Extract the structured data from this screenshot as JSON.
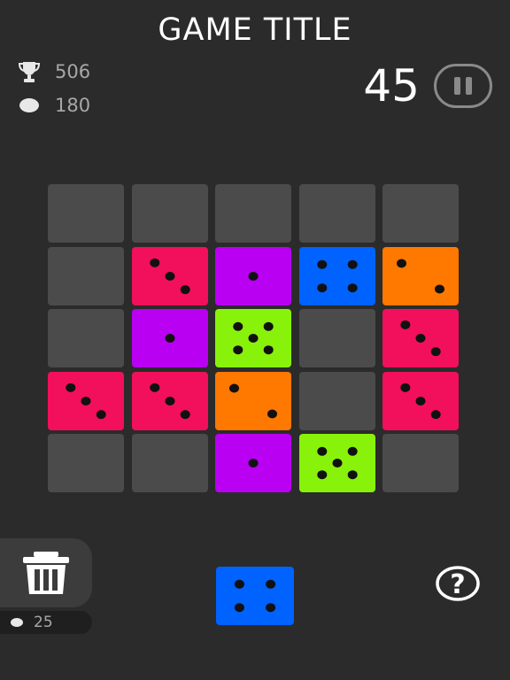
{
  "header": {
    "title": "GAME TITLE",
    "score": "45"
  },
  "stats": {
    "best": "506",
    "coins": "180"
  },
  "trash": {
    "cost": "25"
  },
  "colors": {
    "background": "#2b2b2b",
    "empty": "#4b4b4b",
    "pink": "#f20f5c",
    "purple": "#b900f2",
    "blue": "#0062ff",
    "orange": "#ff7800",
    "green": "#88f20a",
    "pip": "#111111"
  },
  "board": {
    "columns": 5,
    "rows": 5,
    "cells": [
      [
        0,
        0,
        0,
        0,
        0
      ],
      [
        0,
        {
          "color": "pink",
          "value": 3
        },
        {
          "color": "purple",
          "value": 1
        },
        {
          "color": "blue",
          "value": 4
        },
        {
          "color": "orange",
          "value": 2
        }
      ],
      [
        0,
        {
          "color": "purple",
          "value": 1
        },
        {
          "color": "green",
          "value": 5
        },
        0,
        {
          "color": "pink",
          "value": 3
        }
      ],
      [
        {
          "color": "pink",
          "value": 3
        },
        {
          "color": "pink",
          "value": 3
        },
        {
          "color": "orange",
          "value": 2
        },
        0,
        {
          "color": "pink",
          "value": 3
        }
      ],
      [
        0,
        0,
        {
          "color": "purple",
          "value": 1
        },
        {
          "color": "green",
          "value": 5
        },
        0
      ]
    ]
  },
  "next_die": {
    "color": "blue",
    "value": 4
  },
  "icons": {
    "trophy": "trophy-icon",
    "coin": "coin-icon",
    "pause": "pause-icon",
    "trash": "trash-icon",
    "help": "help-icon"
  }
}
